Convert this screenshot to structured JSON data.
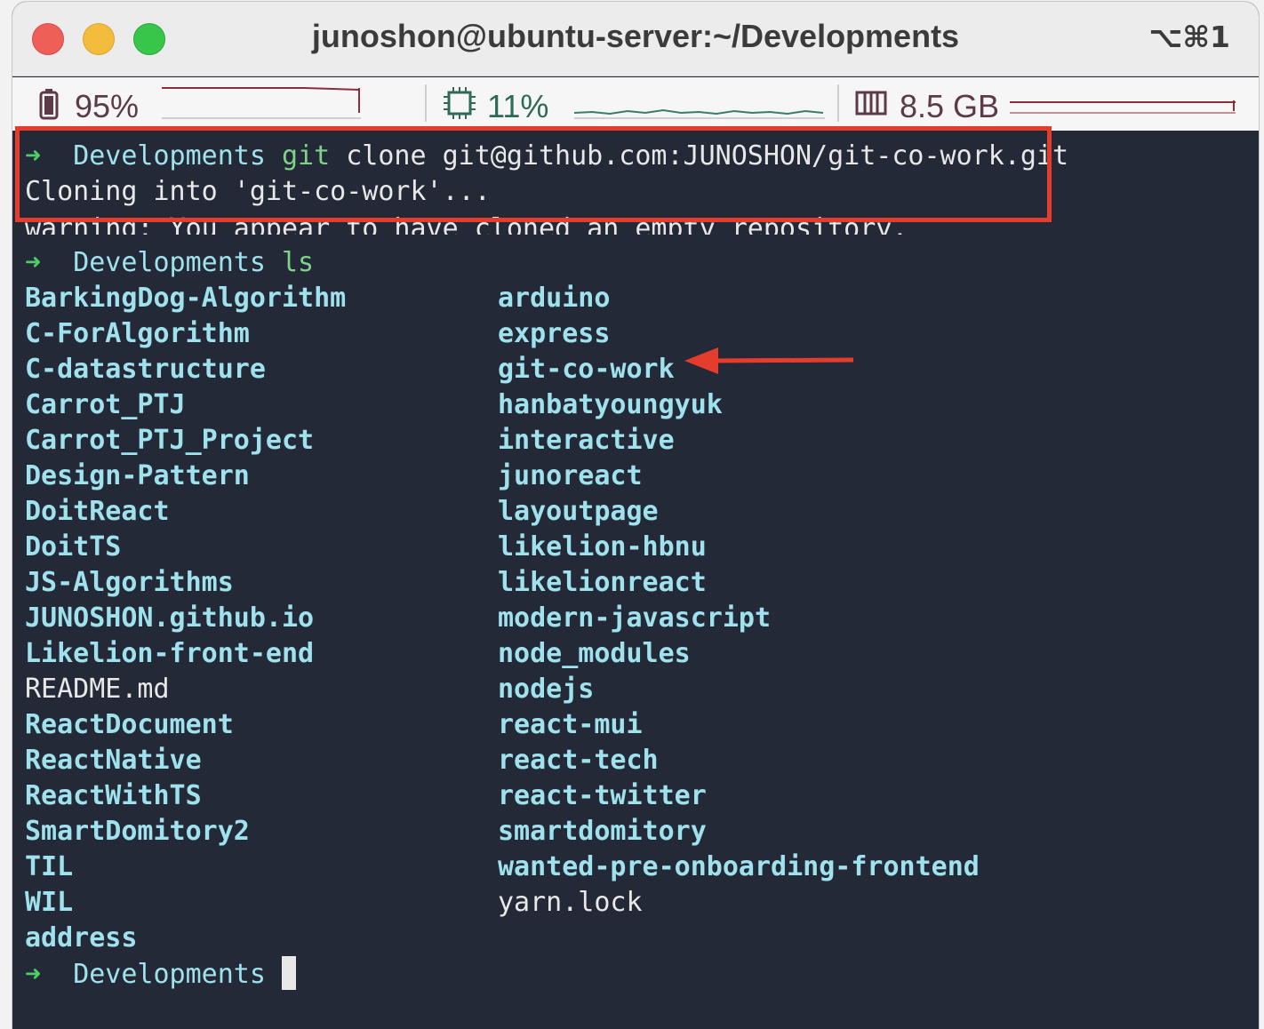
{
  "window": {
    "title": "junoshon@ubuntu-server:~/Developments",
    "shortcut": "⌥⌘1"
  },
  "status": {
    "battery": "95%",
    "cpu": "11%",
    "memory": "8.5 GB",
    "icons": [
      "battery-icon",
      "cpu-chip-icon",
      "memory-icon"
    ]
  },
  "terminal": {
    "prompt_symbol": "➜",
    "cwd": "Developments",
    "cmd1_name": "git",
    "cmd1_args": " clone git@github.com:JUNOSHON/git-co-work.git",
    "clone_output": "Cloning into 'git-co-work'...",
    "warning_output": "warning: You appear to have cloned an empty repository.",
    "cmd2_name": "ls",
    "ls_left": [
      "BarkingDog-Algorithm",
      "C-ForAlgorithm",
      "C-datastructure",
      "Carrot_PTJ",
      "Carrot_PTJ_Project",
      "Design-Pattern",
      "DoitReact",
      "DoitTS",
      "JS-Algorithms",
      "JUNOSHON.github.io",
      "Likelion-front-end",
      "README.md",
      "ReactDocument",
      "ReactNative",
      "ReactWithTS",
      "SmartDomitory2",
      "TIL",
      "WIL",
      "address"
    ],
    "ls_right": [
      "arduino",
      "express",
      "git-co-work",
      "hanbatyoungyuk",
      "interactive",
      "junoreact",
      "layoutpage",
      "likelion-hbnu",
      "likelionreact",
      "modern-javascript",
      "node_modules",
      "nodejs",
      "react-mui",
      "react-tech",
      "react-twitter",
      "smartdomitory",
      "wanted-pre-onboarding-frontend",
      "yarn.lock"
    ]
  },
  "colors": {
    "terminal_bg": "#242937",
    "prompt_arrow": "#4fce68",
    "directory": "#9fe2ee",
    "annotation": "#e53d2d"
  }
}
